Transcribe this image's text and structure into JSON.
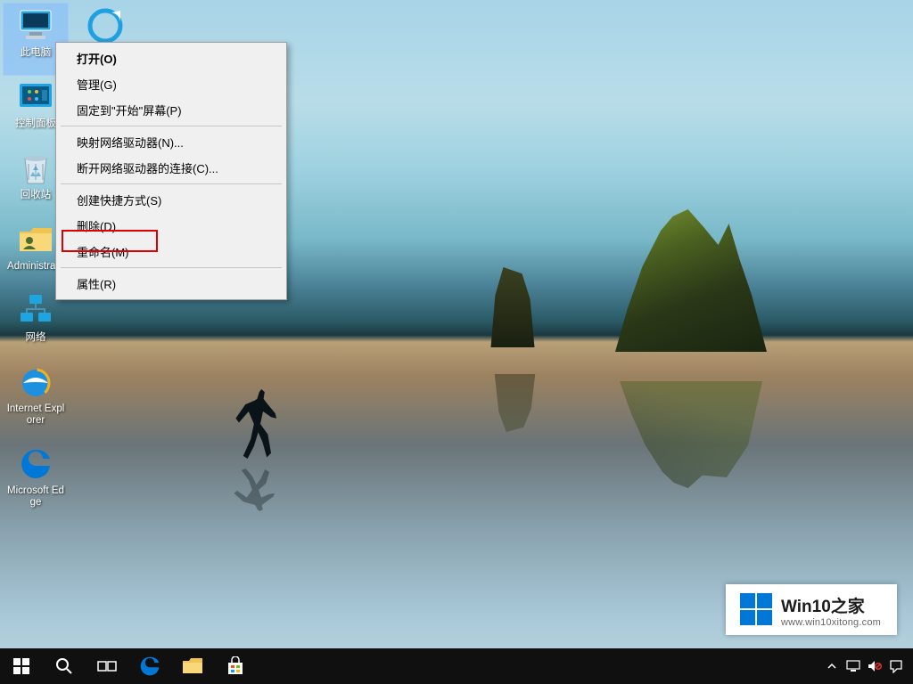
{
  "desktop_icons": {
    "this_pc": "此电脑",
    "qq_browser": "",
    "control_panel": "控制面板",
    "recycle_bin": "回收站",
    "administrator": "Administra...",
    "network": "网络",
    "ie": "Internet Explorer",
    "edge": "Microsoft Edge"
  },
  "context_menu": {
    "open": "打开(O)",
    "manage": "管理(G)",
    "pin_to_start": "固定到\"开始\"屏幕(P)",
    "map_drive": "映射网络驱动器(N)...",
    "disconnect_drive": "断开网络驱动器的连接(C)...",
    "create_shortcut": "创建快捷方式(S)",
    "delete": "删除(D)",
    "rename": "重命名(M)",
    "properties": "属性(R)"
  },
  "watermark": {
    "title": "Win10之家",
    "url": "www.win10xitong.com"
  },
  "colors": {
    "win_blue": "#0078d7",
    "highlight_red": "#e10000"
  }
}
